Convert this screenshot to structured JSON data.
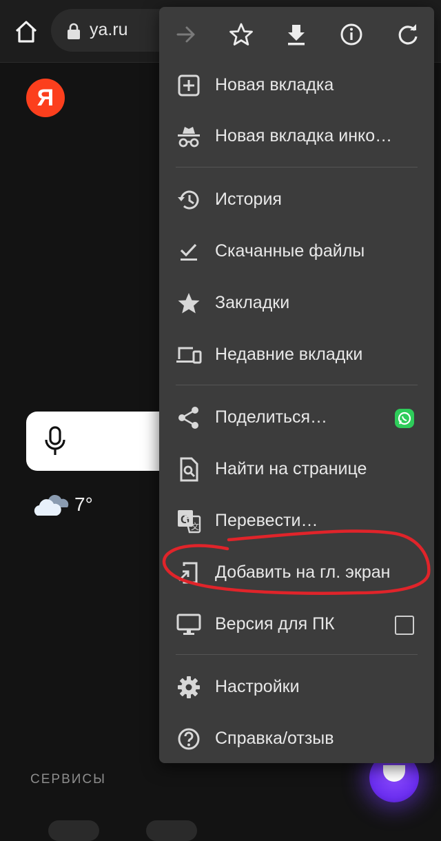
{
  "browser": {
    "url": "ya.ru"
  },
  "page": {
    "logo_letter": "Я",
    "weather_temp": "7°",
    "services_label": "СЕРВИСЫ"
  },
  "menu": {
    "toolbar": [
      "forward-icon",
      "star-icon",
      "download-icon",
      "info-icon",
      "refresh-icon"
    ],
    "items": [
      {
        "label": "Новая вкладка",
        "icon": "new-tab-icon"
      },
      {
        "label": "Новая вкладка инко…",
        "icon": "incognito-icon"
      },
      {
        "label": "История",
        "icon": "history-icon"
      },
      {
        "label": "Скачанные файлы",
        "icon": "downloads-icon"
      },
      {
        "label": "Закладки",
        "icon": "bookmarks-star-icon"
      },
      {
        "label": "Недавние вкладки",
        "icon": "devices-icon"
      },
      {
        "label": "Поделиться…",
        "icon": "share-icon"
      },
      {
        "label": "Найти на странице",
        "icon": "find-in-page-icon"
      },
      {
        "label": "Перевести…",
        "icon": "translate-icon"
      },
      {
        "label": "Добавить на гл. экран",
        "icon": "add-to-home-icon"
      },
      {
        "label": "Версия для ПК",
        "icon": "desktop-icon",
        "checked": false
      },
      {
        "label": "Настройки",
        "icon": "settings-gear-icon"
      },
      {
        "label": "Справка/отзыв",
        "icon": "help-icon"
      }
    ]
  },
  "colors": {
    "annotation": "#e0242a",
    "yandex_red": "#fc3f1d",
    "alice_purple": "#7a3cff",
    "whatsapp": "#2ecc5a"
  }
}
